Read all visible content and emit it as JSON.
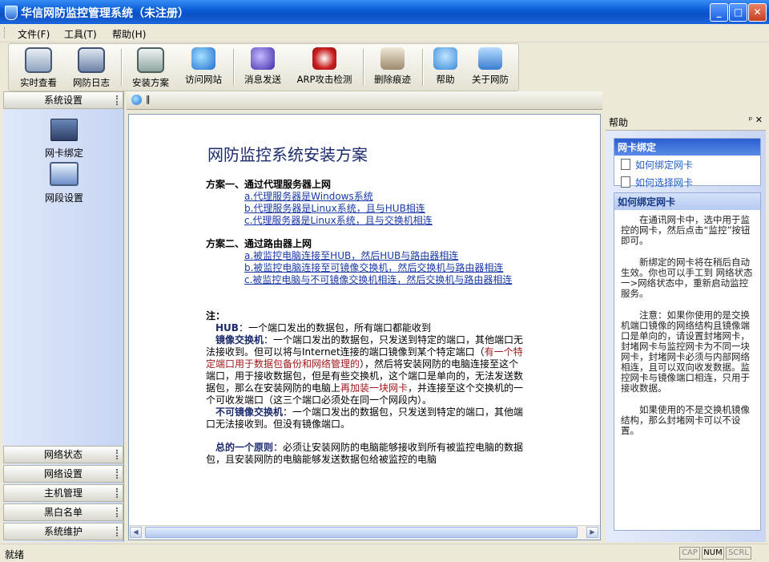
{
  "window": {
    "title": "华信网防监控管理系统（未注册）",
    "minimize": "_",
    "maximize": "□",
    "close": "✕"
  },
  "menu": [
    {
      "label": "文件(F)"
    },
    {
      "label": "工具(T)"
    },
    {
      "label": "帮助(H)"
    }
  ],
  "toolbar": [
    {
      "label": "实时查看",
      "icon": "monitor-icon"
    },
    {
      "label": "网防日志",
      "icon": "log-icon"
    },
    {
      "label": "安装方案",
      "icon": "computer-icon"
    },
    {
      "label": "访问网站",
      "icon": "ie-icon"
    },
    {
      "label": "消息发送",
      "icon": "message-icon"
    },
    {
      "label": "ARP攻击检测",
      "icon": "arp-icon"
    },
    {
      "label": "删除痕迹",
      "icon": "erase-icon"
    },
    {
      "label": "帮助",
      "icon": "help-icon"
    },
    {
      "label": "关于网防",
      "icon": "about-icon"
    }
  ],
  "left": {
    "active_panel": "系统设置",
    "items": [
      {
        "label": "网卡绑定",
        "icon": "nic-icon"
      },
      {
        "label": "网段设置",
        "icon": "segment-icon"
      }
    ],
    "panels": [
      "网络状态",
      "网络设置",
      "主机管理",
      "黑白名单",
      "系统维护"
    ]
  },
  "doc": {
    "tab_text": "‖",
    "title": "网防监控系统安装方案",
    "s1_title": "方案一、通过代理服务器上网",
    "s1_links": [
      "a.代理服务器是Windows系统",
      "b.代理服务器是Linux系统，且与HUB相连",
      "c.代理服务器是Linux系统，且与交换机相连"
    ],
    "s2_title": "方案二、通过路由器上网",
    "s2_link_a": "a.被监控电脑连接至HUB，然后HUB与路由器相连",
    "s2_link_b": "b.被监控电脑连接至可镜像交换机，然后交换机与路由器相连",
    "s2_link_c": "c.被监控电脑与不可镜像交换机相连，然后交换机与路由器相连",
    "note_label": "注：",
    "hub_term": "HUB",
    "hub_text": "：一个端口发出的数据包，所有端口都能收到",
    "mirror_term": "镜像交换机",
    "mirror_text1": "：一个端口发出的数据包，只发送到特定的端口，其他端口无法接收到。但可以将与Internet连接的端口镜像到某个特定端口（",
    "mirror_red1": "有一个特定端口用于数据包备份和网络管理的",
    "mirror_text2": "），然后将安装网防的电脑连接至这个端口，用于接收数据包，但是有些交换机，这个端口是单向的，无法发送数据包，那么在安装网防的电脑上",
    "mirror_red2": "再加装一块网卡",
    "mirror_text3": "，并连接至这个交换机的一个可收发端口（这三个端口必须处在同一个网段内）。",
    "nomirror_term": "不可镜像交换机",
    "nomirror_text": "：一个端口发出的数据包，只发送到特定的端口，其他端口无法接收到。但没有镜像端口。",
    "principle_term": "总的一个原则",
    "principle_text": "：必须让安装网防的电脑能够接收到所有被监控电脑的数据包，且安装网防的电脑能够发送数据包给被监控的电脑"
  },
  "help": {
    "title": "帮助",
    "pin": "ᵖ",
    "close": "✕",
    "box1_title": "网卡绑定",
    "box1_links": [
      "如何绑定网卡",
      "如何选择网卡"
    ],
    "box2_title": "如何绑定网卡",
    "paragraphs": [
      "在通讯网卡中，选中用于监控的网卡，然后点击“监控”按钮即可。",
      "新绑定的网卡将在稍后自动生效。你也可以手工到 网络状态一>网络状态中，重新启动监控服务。",
      "注意：如果你使用的是交换机端口镜像的网络结构且镜像端口是单向的，请设置封堵网卡，封堵网卡与监控网卡为不同一块网卡，封堵网卡必须与内部网络相连，且可以双向收发数据。监控网卡与镜像端口相连，只用于接收数据。",
      "如果使用的不是交换机镜像结构，那么封堵网卡可以不设置。"
    ]
  },
  "status": {
    "text": "就绪",
    "cap": "CAP",
    "num": "NUM",
    "scrl": "SCRL"
  }
}
